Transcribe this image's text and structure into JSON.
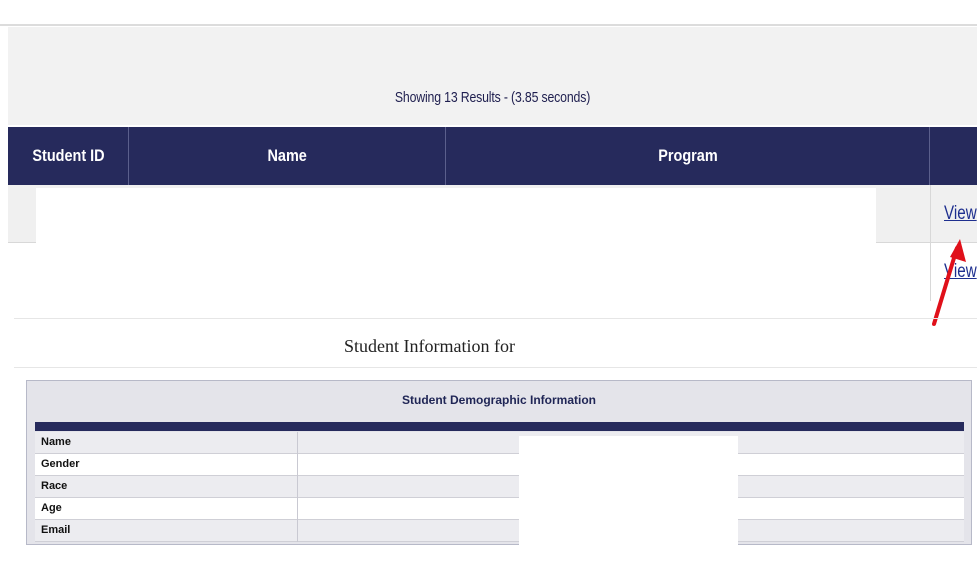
{
  "results": {
    "summary": "Showing 13 Results - (3.85 seconds)"
  },
  "table": {
    "columns": [
      "Student ID",
      "Name",
      "Program",
      ""
    ],
    "rows": [
      {
        "action_label": "View"
      },
      {
        "action_label": "View"
      }
    ]
  },
  "student_info": {
    "title": "Student Information for"
  },
  "demographics": {
    "title": "Student Demographic Information",
    "fields": [
      "Name",
      "Gender",
      "Race",
      "Age",
      "Email"
    ]
  },
  "colors": {
    "header_navy": "#262a5c",
    "link_blue": "#1e2f8f",
    "arrow_red": "#e0101a"
  }
}
